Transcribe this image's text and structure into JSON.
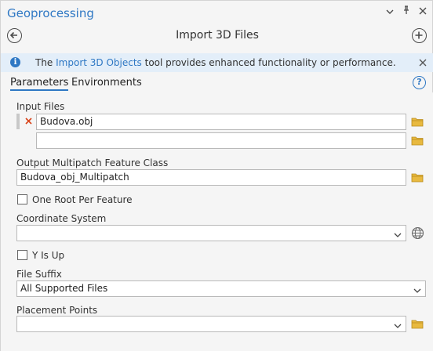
{
  "window": {
    "title": "Geoprocessing",
    "controls": [
      "chevron-down-icon",
      "pin-icon",
      "close-icon"
    ]
  },
  "header": {
    "tool_title": "Import 3D Files",
    "back_icon": "back-arrow-icon",
    "add_icon": "add-icon"
  },
  "banner": {
    "text_before": "The ",
    "link_text": "Import 3D Objects",
    "text_after": " tool provides enhanced functionality or performance.",
    "info_icon": "info-icon",
    "close_icon": "close-icon"
  },
  "tabs": {
    "parameters": "Parameters",
    "environments": "Environments",
    "help_icon": "help-icon"
  },
  "params": {
    "input_files": {
      "label": "Input Files",
      "values": [
        "Budova.obj",
        ""
      ]
    },
    "output_class": {
      "label": "Output Multipatch Feature Class",
      "value": "Budova_obj_Multipatch"
    },
    "one_root": {
      "label": "One Root Per Feature",
      "checked": false
    },
    "coordinate_system": {
      "label": "Coordinate System",
      "value": ""
    },
    "y_is_up": {
      "label": "Y Is Up",
      "checked": false
    },
    "file_suffix": {
      "label": "File Suffix",
      "value": "All Supported Files"
    },
    "placement_points": {
      "label": "Placement Points",
      "value": ""
    }
  },
  "colors": {
    "accent": "#2f78c4",
    "banner_bg": "#e3eef9",
    "remove": "#d9441b",
    "folder": "#e8b93f"
  }
}
